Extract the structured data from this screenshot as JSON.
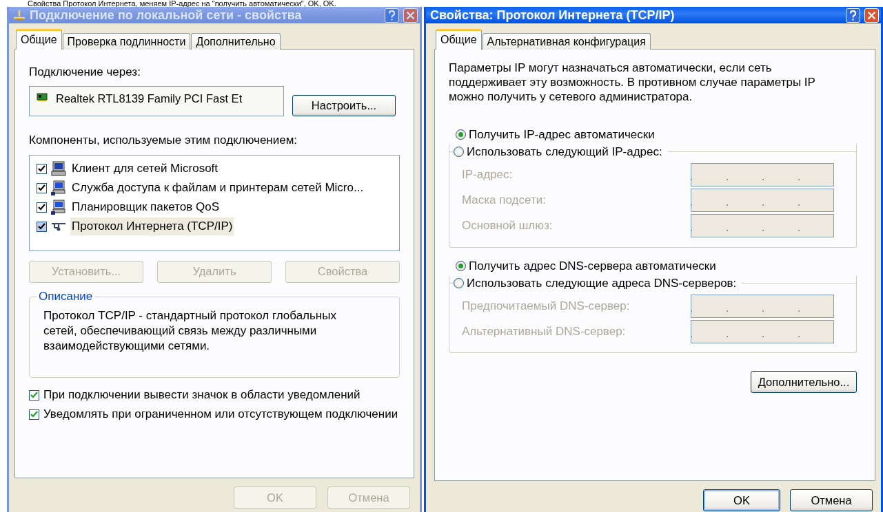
{
  "caption": "Свойства Протокол Интернета, меняем IP-адрес на \"получить автоматически\", OK, OK.",
  "left_dialog": {
    "title": "Подключение по локальной сети - свойства",
    "active": false,
    "tabs": [
      {
        "label": "Общие",
        "selected": true
      },
      {
        "label": "Проверка подлинности",
        "selected": false
      },
      {
        "label": "Дополнительно",
        "selected": false
      }
    ],
    "connect_via_label": "Подключение через:",
    "adapter": "Realtek RTL8139 Family PCI Fast Et",
    "configure_button": "Настроить...",
    "components_label": "Компоненты, используемые этим подключением:",
    "components": [
      {
        "label": "Клиент для сетей Microsoft",
        "checked": true,
        "selected": false,
        "kind": "client"
      },
      {
        "label": "Служба доступа к файлам и принтерам сетей Micro...",
        "checked": true,
        "selected": false,
        "kind": "service"
      },
      {
        "label": "Планировщик пакетов QoS",
        "checked": true,
        "selected": false,
        "kind": "service"
      },
      {
        "label": "Протокол Интернета (TCP/IP)",
        "checked": true,
        "selected": true,
        "kind": "protocol"
      }
    ],
    "component_buttons": [
      {
        "label": "Установить...",
        "disabled": true
      },
      {
        "label": "Удалить",
        "disabled": true
      },
      {
        "label": "Свойства",
        "disabled": true
      }
    ],
    "description": {
      "title": "Описание",
      "text": "Протокол TCP/IP - стандартный протокол глобальных сетей, обеспечивающий связь между различными взаимодействующими сетями."
    },
    "options": [
      {
        "label": "При подключении вывести значок в области уведомлений",
        "checked": true
      },
      {
        "label": "Уведомлять при ограниченном или отсутствующем подключении",
        "checked": true
      }
    ],
    "buttons": [
      {
        "label": "OK",
        "disabled": true
      },
      {
        "label": "Отмена",
        "disabled": true
      }
    ]
  },
  "right_dialog": {
    "title": "Свойства: Протокол Интернета (TCP/IP)",
    "active": true,
    "tabs": [
      {
        "label": "Общие",
        "selected": true
      },
      {
        "label": "Альтернативная конфигурация",
        "selected": false
      }
    ],
    "intro": "Параметры IP могут назначаться автоматически, если сеть поддерживает эту возможность. В противном случае параметры IP можно получить у сетевого администратора.",
    "sections": [
      {
        "auto": {
          "label": "Получить IP-адрес автоматически",
          "selected": true
        },
        "manual": {
          "label": "Использовать следующий IP-адрес:",
          "selected": false
        },
        "fields": [
          {
            "label": "IP-адрес:",
            "disabled": true
          },
          {
            "label": "Маска подсети:",
            "disabled": true
          },
          {
            "label": "Основной шлюз:",
            "disabled": true
          }
        ]
      },
      {
        "auto": {
          "label": "Получить адрес DNS-сервера автоматически",
          "selected": true
        },
        "manual": {
          "label": "Использовать следующие адреса DNS-серверов:",
          "selected": false
        },
        "fields": [
          {
            "label": "Предпочитаемый DNS-сервер:",
            "disabled": true
          },
          {
            "label": "Альтернативный DNS-сервер:",
            "disabled": true
          }
        ]
      }
    ],
    "advanced_button": "Дополнительно...",
    "buttons": [
      {
        "label": "OK",
        "disabled": false,
        "default": true
      },
      {
        "label": "Отмена",
        "disabled": false,
        "default": false
      }
    ]
  }
}
